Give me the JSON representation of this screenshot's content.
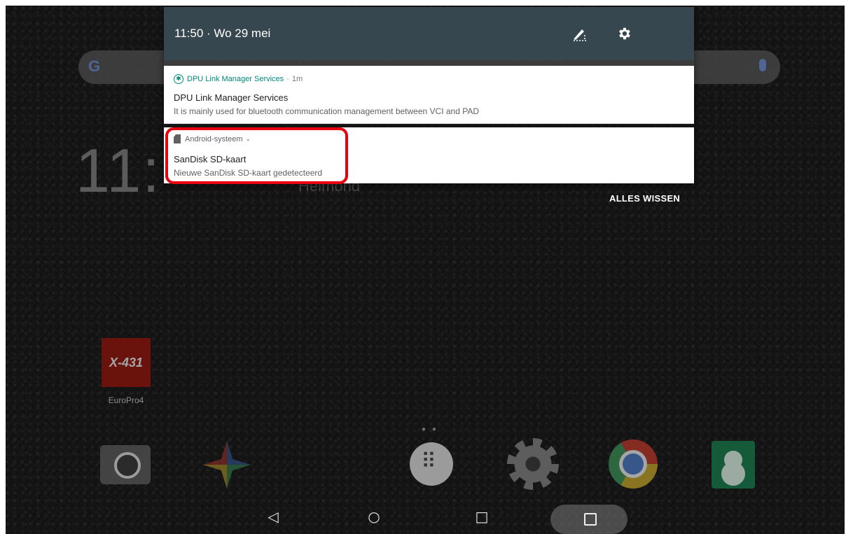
{
  "status": {
    "time_date": "11:50 · Wo 29 mei"
  },
  "notifications": [
    {
      "app_name": "DPU Link Manager Services",
      "age": "1m",
      "title": "DPU Link Manager Services",
      "text": "It is mainly used for bluetooth communication management between VCI and PAD",
      "icon": "bluetooth-icon"
    },
    {
      "app_name": "Android-systeem",
      "title": "SanDisk SD-kaart",
      "text": "Nieuwe SanDisk SD-kaart gedetecteerd",
      "icon": "sd-card-icon"
    }
  ],
  "actions": {
    "clear_all": "ALLES WISSEN"
  },
  "home": {
    "clock_partial": "11:",
    "city_partial": "Helmond",
    "app_label": "EuroPro4",
    "app_logo": "X-431",
    "page_indicator": "● ●"
  },
  "colors": {
    "header_bg": "#37474f",
    "accent": "#00897b",
    "highlight": "#e8000e"
  }
}
